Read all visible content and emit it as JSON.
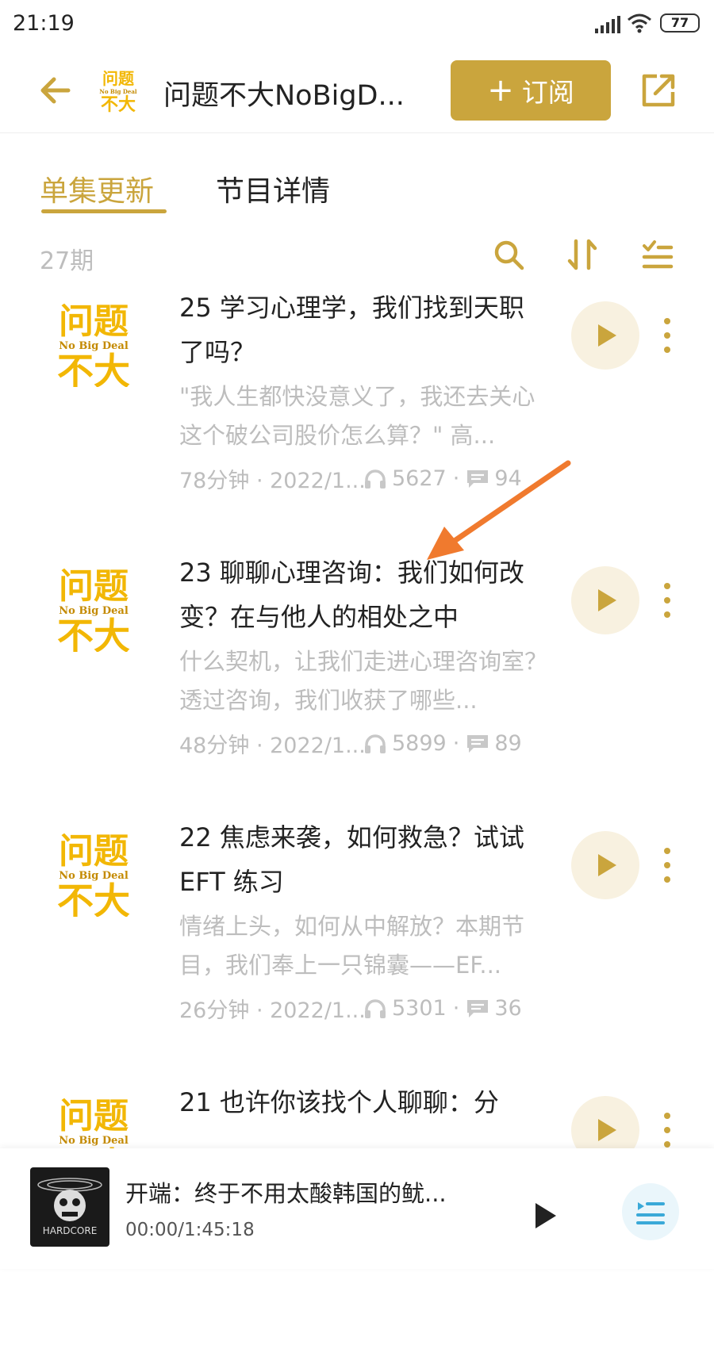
{
  "status": {
    "time": "21:19",
    "battery": "77"
  },
  "header": {
    "title": "问题不大NoBigD...",
    "subscribe_label": "订阅",
    "subscribe_plus": "+"
  },
  "logo": {
    "line1": "问题",
    "line2": "No Big Deal",
    "line3": "不大"
  },
  "tabs": [
    {
      "label": "单集更新",
      "active": true
    },
    {
      "label": "节目详情",
      "active": false
    }
  ],
  "episode_count": "27期",
  "episodes": [
    {
      "title": "25 学习心理学，我们找到天职了吗？",
      "desc": "\"我人生都快没意义了，我还去关心这个破公司股价怎么算？\" 高...",
      "duration": "78分钟 · 2022/1...",
      "plays": "5627",
      "comments": "94"
    },
    {
      "title": "23 聊聊心理咨询：我们如何改变？在与他人的相处之中",
      "desc": "什么契机，让我们走进心理咨询室？透过咨询，我们收获了哪些...",
      "duration": "48分钟 · 2022/1...",
      "plays": "5899",
      "comments": "89"
    },
    {
      "title": "22 焦虑来袭，如何救急？试试 EFT 练习",
      "desc": "情绪上头，如何从中解放？本期节目，我们奉上一只锦囊——EF...",
      "duration": "26分钟 · 2022/1...",
      "plays": "5301",
      "comments": "36"
    },
    {
      "title": "21 也许你该找个人聊聊：分",
      "desc": "",
      "duration": "",
      "plays": "",
      "comments": ""
    }
  ],
  "now_playing": {
    "title": "开端：终于不用太酸韩国的鱿...",
    "time": "00:00/1:45:18",
    "cover_text": "HARDCORE"
  },
  "colors": {
    "accent": "#caa53d",
    "logo_yellow": "#f2b705",
    "annotation": "#f07a2e"
  }
}
